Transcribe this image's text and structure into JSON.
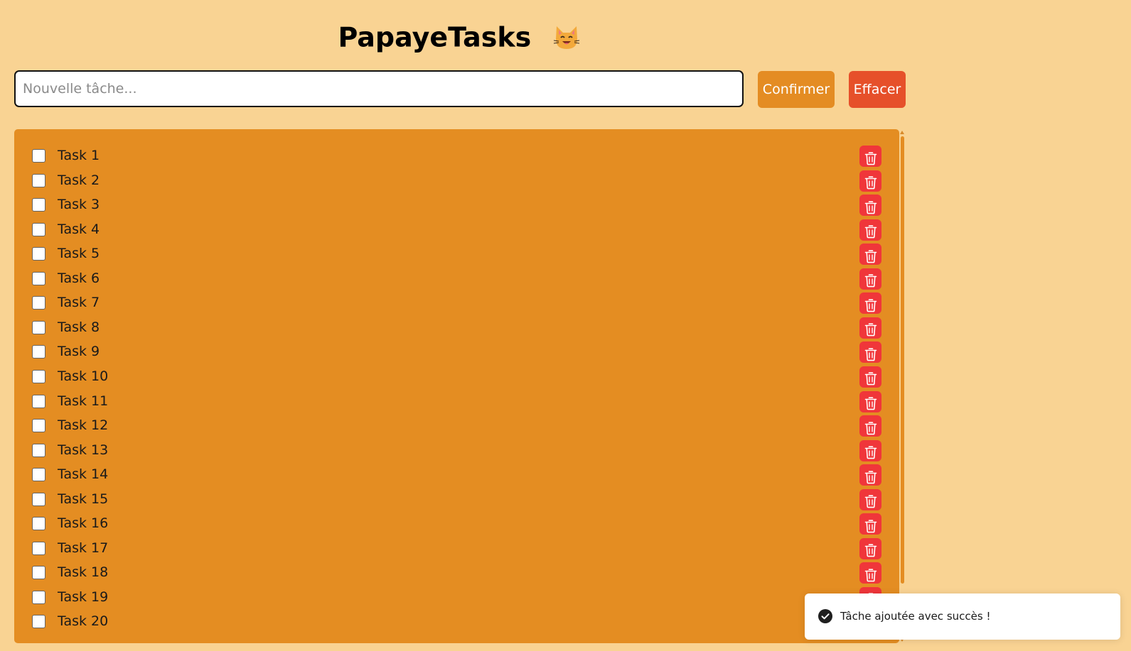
{
  "header": {
    "title": "PapayeTasks",
    "title_emoji_icon": "cat-face-icon"
  },
  "form": {
    "input_placeholder": "Nouvelle tâche...",
    "input_value": "",
    "confirm_label": "Confirmer",
    "clear_label": "Effacer"
  },
  "tasks": [
    {
      "label": "Task 1",
      "checked": false
    },
    {
      "label": "Task 2",
      "checked": false
    },
    {
      "label": "Task 3",
      "checked": false
    },
    {
      "label": "Task 4",
      "checked": false
    },
    {
      "label": "Task 5",
      "checked": false
    },
    {
      "label": "Task 6",
      "checked": false
    },
    {
      "label": "Task 7",
      "checked": false
    },
    {
      "label": "Task 8",
      "checked": false
    },
    {
      "label": "Task 9",
      "checked": false
    },
    {
      "label": "Task 10",
      "checked": false
    },
    {
      "label": "Task 11",
      "checked": false
    },
    {
      "label": "Task 12",
      "checked": false
    },
    {
      "label": "Task 13",
      "checked": false
    },
    {
      "label": "Task 14",
      "checked": false
    },
    {
      "label": "Task 15",
      "checked": false
    },
    {
      "label": "Task 16",
      "checked": false
    },
    {
      "label": "Task 17",
      "checked": false
    },
    {
      "label": "Task 18",
      "checked": false
    },
    {
      "label": "Task 19",
      "checked": false
    },
    {
      "label": "Task 20",
      "checked": false
    }
  ],
  "task_delete_icon": "trash-icon",
  "toast": {
    "message": "Tâche ajoutée avec succès !",
    "icon": "check-circle-icon"
  },
  "colors": {
    "background": "#f9d393",
    "panel": "#e48d22",
    "confirm_button": "#e48c23",
    "clear_button": "#e6502a",
    "delete_button": "#f0363a"
  }
}
